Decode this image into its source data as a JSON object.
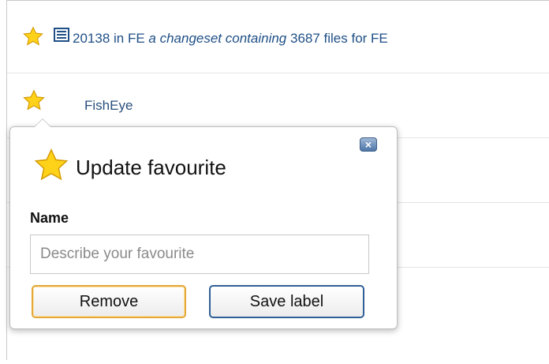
{
  "rows": [
    {
      "id": "20138",
      "repo_prefix": " in FE ",
      "italic_text": "a changeset containing",
      "suffix": " 3687 files for FE",
      "star_icon": "star-icon",
      "type_icon": "changeset-doc-icon"
    },
    {
      "label": "FishEye",
      "star_icon": "star-icon"
    }
  ],
  "popup": {
    "title": "Update favourite",
    "name_label": "Name",
    "name_placeholder": "Describe your favourite",
    "name_value": "",
    "remove_label": "Remove",
    "save_label": "Save label",
    "close_icon": "close-icon",
    "title_icon": "star-icon"
  },
  "colors": {
    "star_fill": "#ffd21a",
    "link": "#1f4f86",
    "remove_border": "#e3a83b",
    "save_border": "#2f5f96"
  }
}
